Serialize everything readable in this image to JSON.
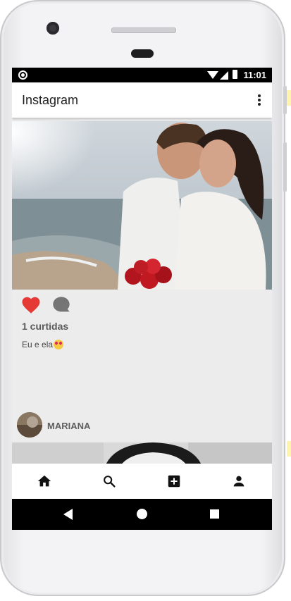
{
  "status_bar": {
    "time": "11:01"
  },
  "app_bar": {
    "title": "Instagram",
    "menu_icon": "more-vert-icon"
  },
  "post": {
    "liked": true,
    "likes_text": "1 curtidas",
    "caption": "Eu e ela",
    "caption_emoji": "heart-eyes-emoji",
    "icons": [
      "heart-icon",
      "comment-icon"
    ],
    "colors": {
      "heart": "#e53935",
      "comment": "#757575"
    }
  },
  "next_post": {
    "username": "MARIANA"
  },
  "bottom_nav": {
    "items": [
      {
        "name": "home",
        "icon": "home-icon"
      },
      {
        "name": "search",
        "icon": "search-icon"
      },
      {
        "name": "add",
        "icon": "add-box-icon"
      },
      {
        "name": "profile",
        "icon": "person-icon"
      }
    ]
  },
  "system_nav": {
    "items": [
      "back-icon",
      "home-circle-icon",
      "recents-icon"
    ]
  }
}
